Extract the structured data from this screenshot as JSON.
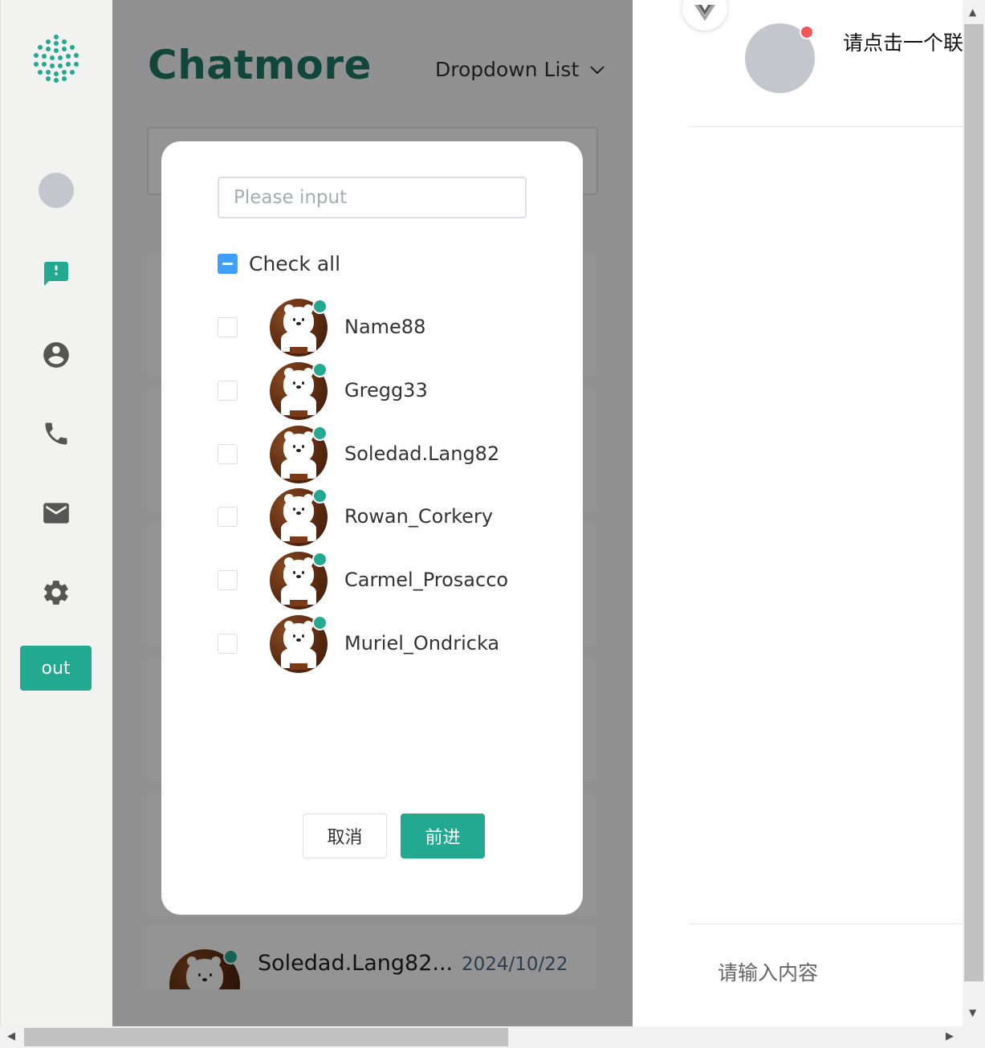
{
  "sidebar": {
    "logo_icon": "hexagon-dots-logo",
    "items": [
      {
        "icon": "user-avatar"
      },
      {
        "icon": "chat-alert-icon"
      },
      {
        "icon": "account-circle-icon"
      },
      {
        "icon": "phone-icon"
      },
      {
        "icon": "mail-icon"
      },
      {
        "icon": "gear-icon"
      }
    ],
    "out_label": "out"
  },
  "middle": {
    "brand": "Chatmore",
    "dropdown_label": "Dropdown List",
    "bottom_card": {
      "name": "Soledad.Lang82...",
      "date": "2024/10/22"
    }
  },
  "right": {
    "title": "请点击一个联系人",
    "input_placeholder": "请输入内容"
  },
  "modal": {
    "search_placeholder": "Please input",
    "check_all_label": "Check all",
    "users": [
      {
        "name": "Name88"
      },
      {
        "name": "Gregg33"
      },
      {
        "name": "Soledad.Lang82"
      },
      {
        "name": "Rowan_Corkery"
      },
      {
        "name": "Carmel_Prosacco"
      },
      {
        "name": "Muriel_Ondricka"
      }
    ],
    "cancel_label": "取消",
    "next_label": "前进"
  },
  "colors": {
    "brand": "#1e7a66",
    "accent": "#22a98f",
    "checkbox_active": "#409eff",
    "notify_dot": "#ee5a5a"
  }
}
